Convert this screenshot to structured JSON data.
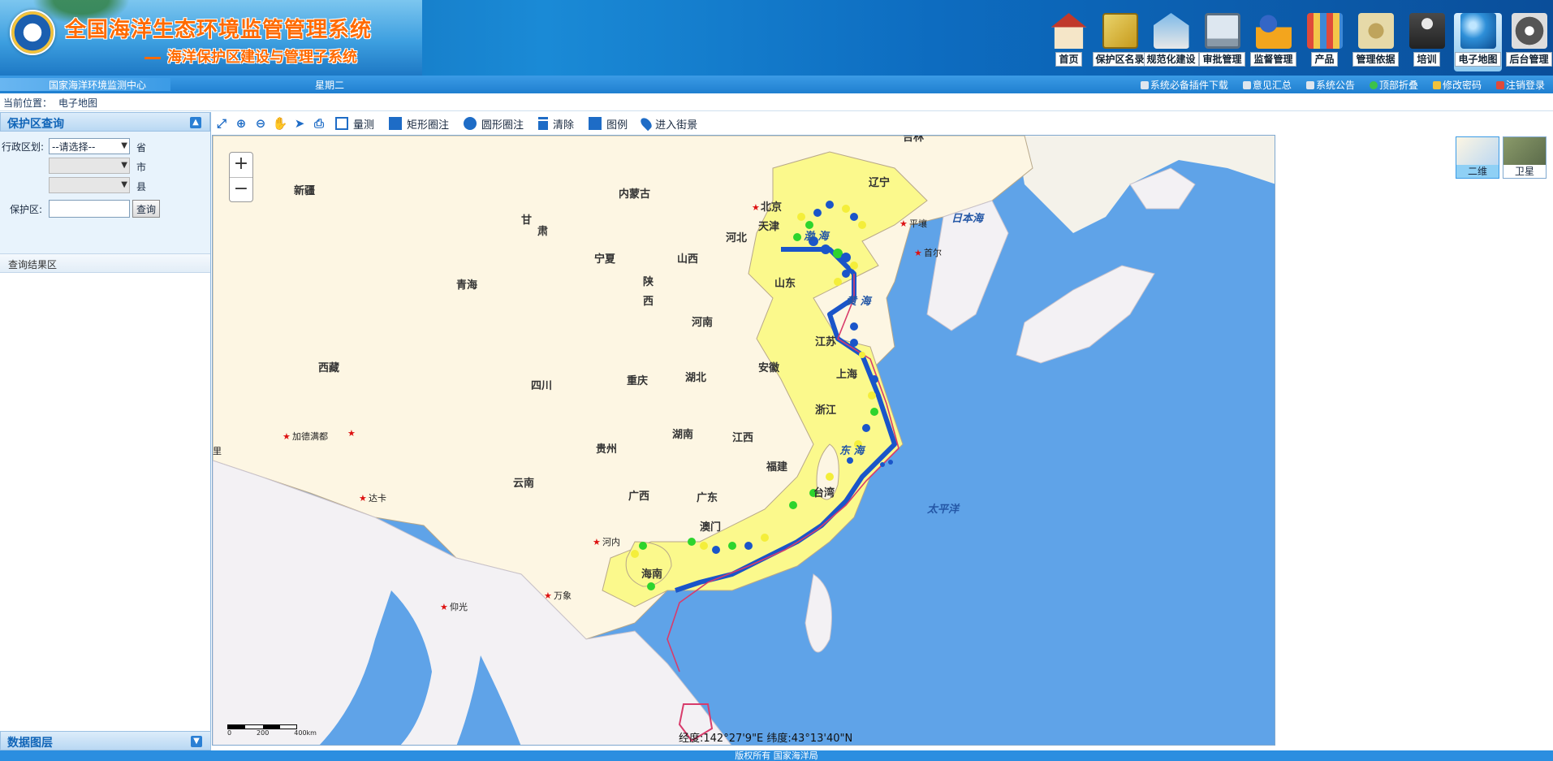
{
  "header": {
    "title": "全国海洋生态环境监管管理系统",
    "subtitle": "海洋保护区建设与管理子系统",
    "nav": [
      {
        "label": "首页",
        "icon": "home-icon",
        "active": false
      },
      {
        "label": "保护区名录",
        "icon": "book-icon",
        "active": false
      },
      {
        "label": "规范化建设",
        "icon": "building-icon",
        "active": false
      },
      {
        "label": "审批管理",
        "icon": "monitor-icon",
        "active": false
      },
      {
        "label": "监督管理",
        "icon": "warning-icon",
        "active": false
      },
      {
        "label": "产品",
        "icon": "files-icon",
        "active": false
      },
      {
        "label": "管理依据",
        "icon": "documents-icon",
        "active": false
      },
      {
        "label": "培训",
        "icon": "person-icon",
        "active": false
      },
      {
        "label": "电子地图",
        "icon": "globe-icon",
        "active": true
      },
      {
        "label": "后台管理",
        "icon": "settings-icon",
        "active": false
      }
    ]
  },
  "subbar": {
    "org": "国家海洋环境监测中心",
    "weekday": "星期二",
    "links": [
      "系统必备插件下载",
      "意见汇总",
      "系统公告",
      "顶部折叠",
      "修改密码",
      "注销登录"
    ]
  },
  "breadcrumb": {
    "label": "当前位置：",
    "current": "电子地图"
  },
  "sidebar": {
    "query_title": "保护区查询",
    "region_label": "行政区划:",
    "province_select": "--请选择--",
    "province_unit": "省",
    "city_unit": "市",
    "county_unit": "县",
    "reserve_label": "保护区:",
    "reserve_value": "",
    "query_button": "查询",
    "result_title": "查询结果区",
    "layer_title": "数据图层"
  },
  "toolbar": {
    "measure": "量测",
    "rect_mark": "矩形圈注",
    "circle_mark": "圆形圈注",
    "clear": "清除",
    "legend": "图例",
    "street_view": "进入街景"
  },
  "map": {
    "zoom_in": "+",
    "zoom_out": "−",
    "coord": "经度:142°27'9\"E 纬度:43°13'40\"N",
    "scale_labels": [
      "0",
      "200",
      "400km"
    ],
    "map_types": [
      "二维",
      "卫星"
    ],
    "colors": {
      "sea": "#5fa3e8",
      "land": "#fdf6e3",
      "coastal": "#fbf98c",
      "border": "#b8a88a",
      "reserve_blue": "#1a55c9",
      "reserve_green": "#2dd42d",
      "reserve_yellow": "#f4ee3a"
    },
    "labels": {
      "xinjiang": "新疆",
      "neimenggu": "内蒙古",
      "gan": "甘",
      "su": "肃",
      "ningxia": "宁夏",
      "qinghai": "青海",
      "shaan": "陕",
      "xi2": "西",
      "shanxi": "山西",
      "henan": "河南",
      "hebei": "河北",
      "beijing": "北京",
      "tianjin": "天津",
      "liaoning": "辽宁",
      "jilin": "吉林",
      "shandong": "山东",
      "jiangsu": "江苏",
      "anhui": "安徽",
      "shanghai": "上海",
      "hubei": "湖北",
      "zhejiang": "浙江",
      "xizang": "西藏",
      "sichuan": "四川",
      "chongqing": "重庆",
      "hunan": "湖南",
      "jiangxi": "江西",
      "guizhou": "贵州",
      "fujian": "福建",
      "taiwan": "台湾",
      "yunnan": "云南",
      "guangxi": "广西",
      "guangdong": "广东",
      "aomen": "澳门",
      "hainan": "海南",
      "bohai": "渤 海",
      "huanghai": "黄 海",
      "donghai": "东 海",
      "taipingyang": "太平洋",
      "ribenhai": "日本海",
      "pingrang": "平壤",
      "shouer": "首尔",
      "jiademan": "加德满都",
      "daka": "达卡",
      "henei": "河内",
      "yangguang": "仰光",
      "wanxiang": "万象",
      "li": "里"
    }
  },
  "footer": "版权所有 国家海洋局"
}
